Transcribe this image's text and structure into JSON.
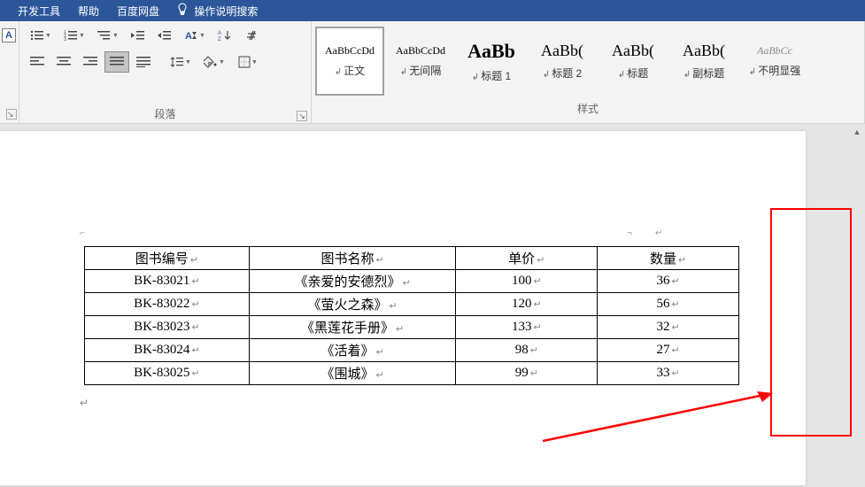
{
  "menu": {
    "dev_tools": "开发工具",
    "help": "帮助",
    "baidu": "百度网盘",
    "search": "操作说明搜索"
  },
  "ribbon": {
    "paragraph_label": "段落",
    "styles_label": "样式",
    "text_direction": "A"
  },
  "styles": [
    {
      "preview": "AaBbCcDd",
      "label": "正文",
      "cls": "",
      "selected": true
    },
    {
      "preview": "AaBbCcDd",
      "label": "无间隔",
      "cls": ""
    },
    {
      "preview": "AaBb",
      "label": "标题 1",
      "cls": "big"
    },
    {
      "preview": "AaBb(",
      "label": "标题 2",
      "cls": "med"
    },
    {
      "preview": "AaBb(",
      "label": "标题",
      "cls": "med"
    },
    {
      "preview": "AaBb(",
      "label": "副标题",
      "cls": "med"
    },
    {
      "preview": "AaBbCc",
      "label": "不明显强",
      "cls": "italic"
    }
  ],
  "table": {
    "headers": [
      "图书编号",
      "图书名称",
      "单价",
      "数量"
    ],
    "rows": [
      [
        "BK-83021",
        "《亲爱的安德烈》",
        "100",
        "36"
      ],
      [
        "BK-83022",
        "《萤火之森》",
        "120",
        "56"
      ],
      [
        "BK-83023",
        "《黑莲花手册》",
        "133",
        "32"
      ],
      [
        "BK-83024",
        "《活着》",
        "98",
        "27"
      ],
      [
        "BK-83025",
        "《围城》",
        "99",
        "33"
      ]
    ]
  }
}
